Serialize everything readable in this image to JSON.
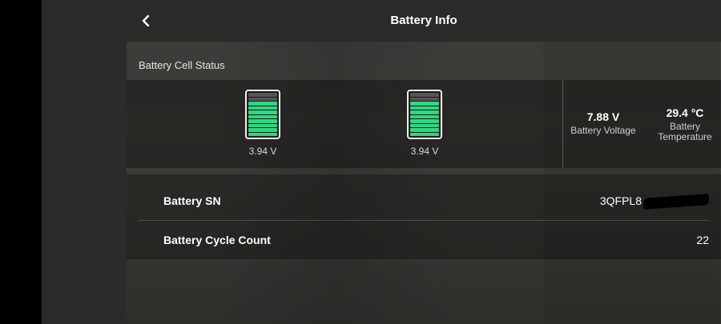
{
  "header": {
    "title": "Battery Info",
    "back_icon": "chevron-left-icon"
  },
  "cell_status": {
    "section_label": "Battery Cell Status",
    "cells": [
      {
        "voltage": "3.94 V",
        "fill_bars_lit": 8,
        "fill_bars_total": 10
      },
      {
        "voltage": "3.94 V",
        "fill_bars_lit": 8,
        "fill_bars_total": 10
      }
    ],
    "battery_voltage": {
      "value": "7.88 V",
      "label": "Battery Voltage"
    },
    "battery_temperature": {
      "value": "29.4 °C",
      "label": "Battery Temperature"
    }
  },
  "details": {
    "sn": {
      "label": "Battery SN",
      "value": "3QFPL8"
    },
    "cycle_count": {
      "label": "Battery Cycle Count",
      "value": "22"
    }
  },
  "colors": {
    "cell_full": "#2fd683",
    "cell_empty": "#555555",
    "header_bg": "#2a2a28"
  }
}
